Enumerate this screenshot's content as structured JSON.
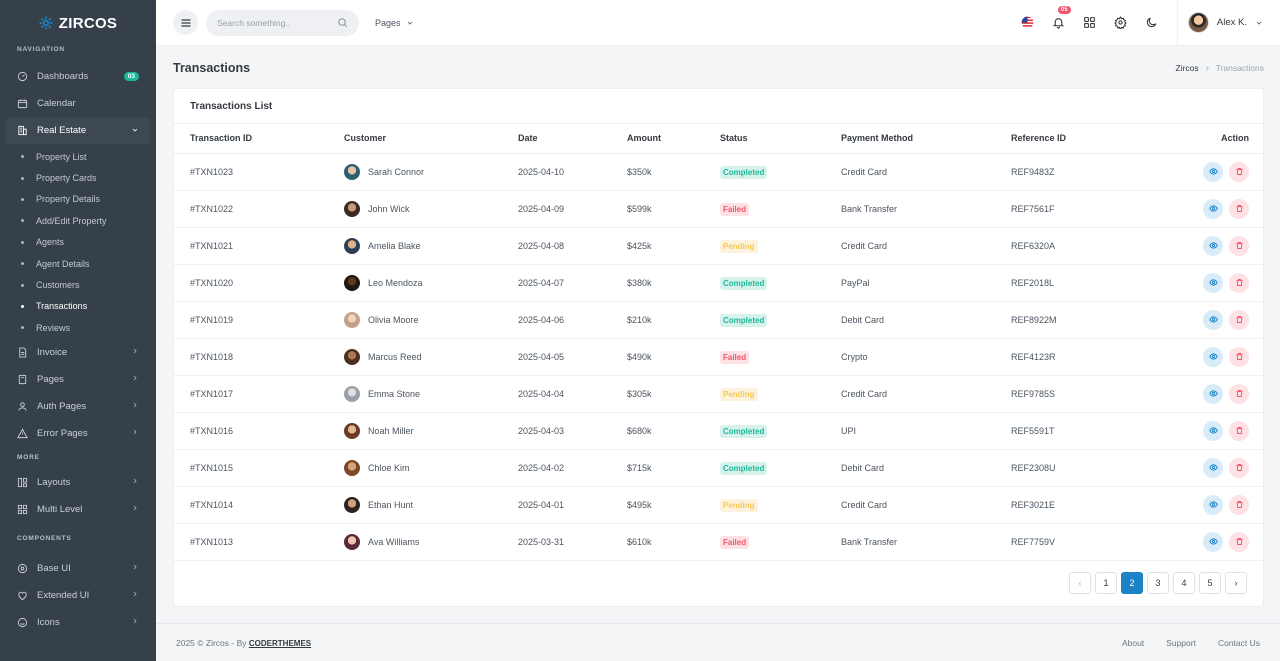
{
  "brand": {
    "name": "ZIRCOS"
  },
  "sidebar": {
    "sections": [
      {
        "title": "NAVIGATION"
      },
      {
        "title": "MORE"
      },
      {
        "title": "COMPONENTS"
      }
    ],
    "items": [
      {
        "label": "Dashboards",
        "badge": "03",
        "icon": "dashboard-icon"
      },
      {
        "label": "Calendar",
        "icon": "calendar-icon"
      },
      {
        "label": "Real Estate",
        "icon": "building-icon"
      },
      {
        "label": "Invoice",
        "icon": "invoice-icon"
      },
      {
        "label": "Pages",
        "icon": "pages-icon"
      },
      {
        "label": "Auth Pages",
        "icon": "auth-icon"
      },
      {
        "label": "Error Pages",
        "icon": "error-icon"
      },
      {
        "label": "Layouts",
        "icon": "layouts-icon"
      },
      {
        "label": "Multi Level",
        "icon": "multi-level-icon"
      },
      {
        "label": "Base UI",
        "icon": "base-ui-icon"
      },
      {
        "label": "Extended UI",
        "icon": "extended-ui-icon"
      },
      {
        "label": "Icons",
        "icon": "icons-icon"
      }
    ],
    "real_estate_sub": [
      "Property List",
      "Property Cards",
      "Property Details",
      "Add/Edit Property",
      "Agents",
      "Agent Details",
      "Customers",
      "Transactions",
      "Reviews"
    ]
  },
  "topbar": {
    "search_placeholder": "Search something..",
    "pages_label": "Pages",
    "notification_count": "05",
    "user_name": "Alex K."
  },
  "page": {
    "title": "Transactions",
    "breadcrumb": [
      "Zircos",
      "Transactions"
    ]
  },
  "card": {
    "title": "Transactions List"
  },
  "table": {
    "columns": [
      "Transaction ID",
      "Customer",
      "Date",
      "Amount",
      "Status",
      "Payment Method",
      "Reference ID",
      "Action"
    ],
    "rows": [
      {
        "id": "#TXN1023",
        "customer": "Sarah Connor",
        "date": "2025-04-10",
        "amount": "$350k",
        "status": "Completed",
        "method": "Credit Card",
        "ref": "REF9483Z"
      },
      {
        "id": "#TXN1022",
        "customer": "John Wick",
        "date": "2025-04-09",
        "amount": "$599k",
        "status": "Failed",
        "method": "Bank Transfer",
        "ref": "REF7561F"
      },
      {
        "id": "#TXN1021",
        "customer": "Amelia Blake",
        "date": "2025-04-08",
        "amount": "$425k",
        "status": "Pending",
        "method": "Credit Card",
        "ref": "REF6320A"
      },
      {
        "id": "#TXN1020",
        "customer": "Leo Mendoza",
        "date": "2025-04-07",
        "amount": "$380k",
        "status": "Completed",
        "method": "PayPal",
        "ref": "REF2018L"
      },
      {
        "id": "#TXN1019",
        "customer": "Olivia Moore",
        "date": "2025-04-06",
        "amount": "$210k",
        "status": "Completed",
        "method": "Debit Card",
        "ref": "REF8922M"
      },
      {
        "id": "#TXN1018",
        "customer": "Marcus Reed",
        "date": "2025-04-05",
        "amount": "$490k",
        "status": "Failed",
        "method": "Crypto",
        "ref": "REF4123R"
      },
      {
        "id": "#TXN1017",
        "customer": "Emma Stone",
        "date": "2025-04-04",
        "amount": "$305k",
        "status": "Pending",
        "method": "Credit Card",
        "ref": "REF9785S"
      },
      {
        "id": "#TXN1016",
        "customer": "Noah Miller",
        "date": "2025-04-03",
        "amount": "$680k",
        "status": "Completed",
        "method": "UPI",
        "ref": "REF5591T"
      },
      {
        "id": "#TXN1015",
        "customer": "Chloe Kim",
        "date": "2025-04-02",
        "amount": "$715k",
        "status": "Completed",
        "method": "Debit Card",
        "ref": "REF2308U"
      },
      {
        "id": "#TXN1014",
        "customer": "Ethan Hunt",
        "date": "2025-04-01",
        "amount": "$495k",
        "status": "Pending",
        "method": "Credit Card",
        "ref": "REF3021E"
      },
      {
        "id": "#TXN1013",
        "customer": "Ava Williams",
        "date": "2025-03-31",
        "amount": "$610k",
        "status": "Failed",
        "method": "Bank Transfer",
        "ref": "REF7759V"
      }
    ]
  },
  "pagination": {
    "pages": [
      "1",
      "2",
      "3",
      "4",
      "5"
    ],
    "current": "2",
    "prev": "‹",
    "next": "›"
  },
  "footer": {
    "copyright": "2025 © Zircos - By",
    "author": "CODERTHEMES",
    "links": [
      "About",
      "Support",
      "Contact Us"
    ]
  },
  "colors": {
    "sidebar_bg": "#36404a",
    "primary": "#1c84c6",
    "success": "#1bb99a",
    "danger": "#f1556c",
    "warning": "#f9c851"
  }
}
